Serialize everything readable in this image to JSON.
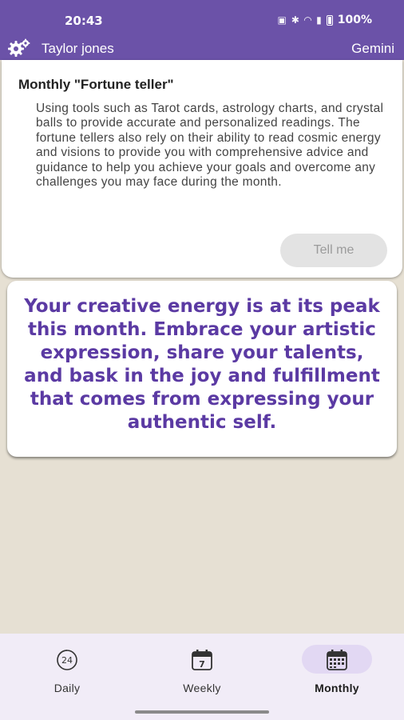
{
  "status_bar": {
    "time": "20:43",
    "battery": "100%",
    "icons": [
      "nfc-icon",
      "bluetooth-icon",
      "wifi-icon",
      "signal-icon",
      "battery-icon"
    ]
  },
  "app_bar": {
    "user_name": "Taylor jones",
    "zodiac_sign": "Gemini",
    "settings_icon": "gear-icon"
  },
  "fortune_card": {
    "title": "Monthly \"Fortune teller\"",
    "description": "Using tools such as Tarot cards, astrology charts, and crystal balls to provide accurate and personalized readings. The fortune tellers also rely on their ability to read cosmic energy and visions to provide you with comprehensive advice and guidance to help you achieve your goals and overcome any challenges you may face during the month.",
    "button_label": "Tell me"
  },
  "reading": {
    "text": "Your creative energy is at its peak this month. Embrace your artistic expression, share your talents, and bask in the joy and fulfillment that comes from expressing your authentic self."
  },
  "bottom_nav": {
    "items": [
      {
        "label": "Daily",
        "icon": "clock-24-icon",
        "active": false
      },
      {
        "label": "Weekly",
        "icon": "calendar-week-icon",
        "active": false
      },
      {
        "label": "Monthly",
        "icon": "calendar-month-icon",
        "active": true
      }
    ]
  },
  "colors": {
    "header": "#6b52a8",
    "reading_text": "#5b3aa3",
    "background": "#e6e0d3",
    "nav_background": "#f1ecf7",
    "nav_active_pill": "#e2d8f3"
  }
}
